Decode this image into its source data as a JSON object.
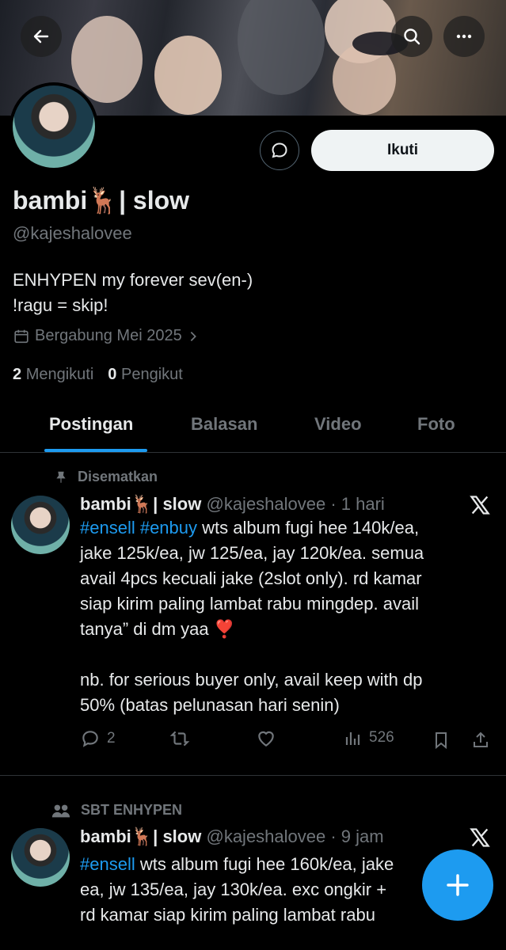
{
  "profile": {
    "name": "bambi🦌| slow",
    "handle": "@kajeshalovee",
    "bio_line1": "ENHYPEN my forever sev(en-)",
    "bio_line2": "!ragu = skip!",
    "joined": "Bergabung Mei 2025",
    "following_count": "2",
    "following_label": "Mengikuti",
    "followers_count": "0",
    "followers_label": "Pengikut",
    "follow_button": "Ikuti"
  },
  "tabs": [
    "Postingan",
    "Balasan",
    "Video",
    "Foto"
  ],
  "posts": [
    {
      "context": "Disematkan",
      "name": "bambi🦌| slow",
      "handle_time": "@kajeshalovee · 1 hari",
      "tags": "#ensell #enbuy",
      "body_first": " wts album fugi hee 140k/ea,",
      "body_rest": "jake 125k/ea, jw 125/ea, jay 120k/ea. semua\navail 4pcs kecuali jake (2slot only). rd kamar\nsiap kirim paling lambat rabu mingdep. avail\ntanya” di dm yaa ❣️\n\nnb. for serious buyer only, avail keep with dp\n50% (batas pelunasan hari senin)",
      "replies": "2",
      "reposts": "",
      "likes": "",
      "views": "526"
    },
    {
      "context": "SBT ENHYPEN",
      "name": "bambi🦌| slow",
      "handle_time": "@kajeshalovee · 9 jam",
      "tags": "#ensell",
      "body_first": " wts album fugi hee 160k/ea, jake",
      "body_rest": "ea, jw 135/ea, jay 130k/ea. exc ongkir +\nrd kamar siap kirim paling lambat rabu"
    }
  ],
  "colors": {
    "accent": "#1d9bf0",
    "background": "#000000",
    "text": "#e7e9ea",
    "muted": "#71767b"
  }
}
